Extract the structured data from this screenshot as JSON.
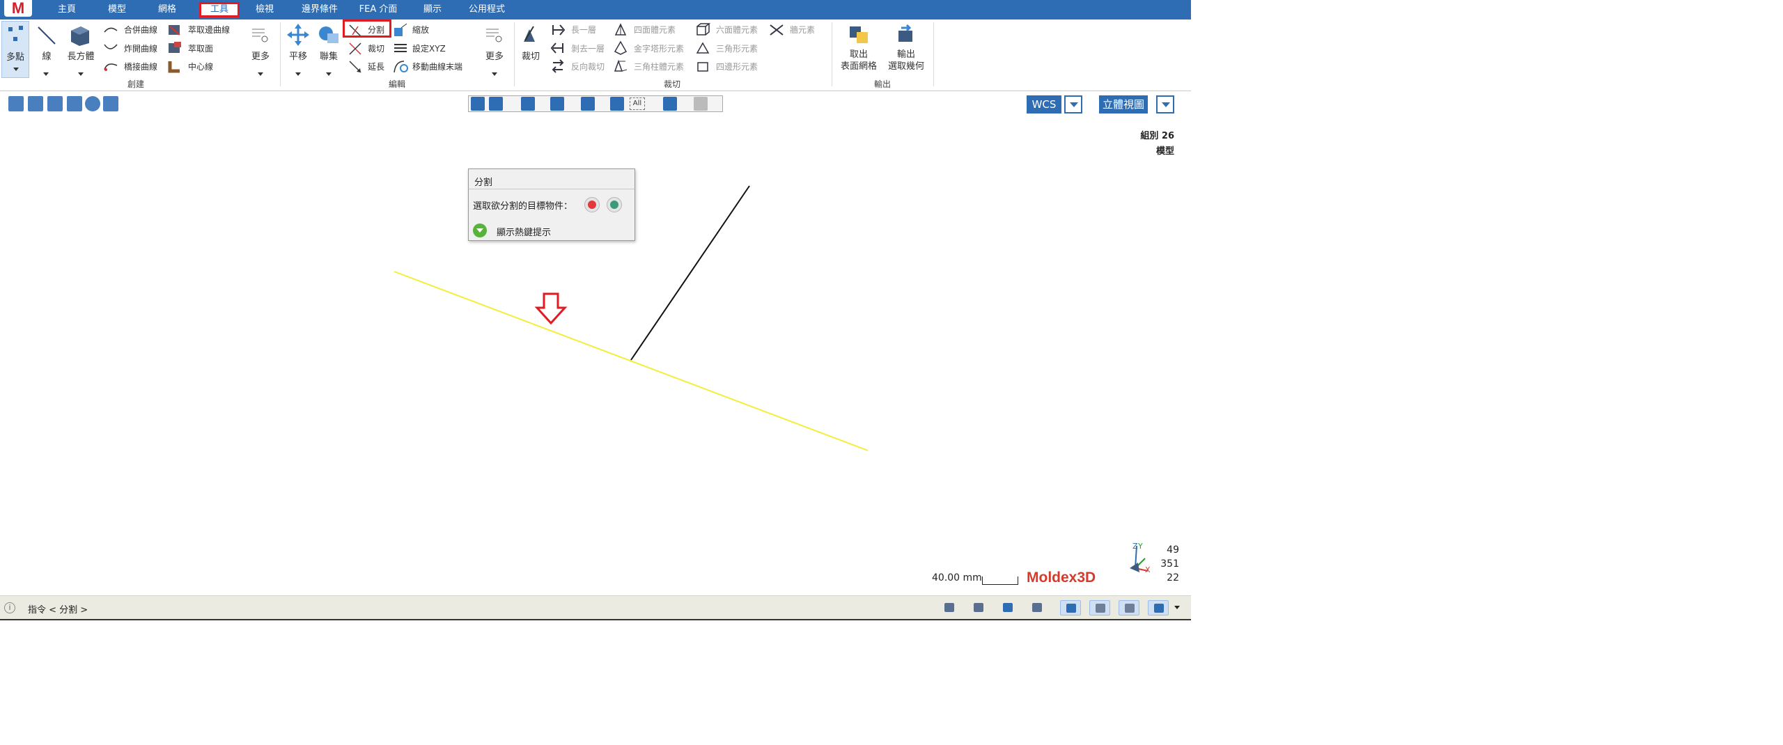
{
  "logo_letter": "M",
  "tabs": [
    "主頁",
    "模型",
    "網格",
    "工具",
    "檢視",
    "邊界條件",
    "FEA 介面",
    "顯示",
    "公用程式"
  ],
  "active_tab": "工具",
  "ribbon": {
    "create_group": {
      "label": "創建",
      "multi_point": "多點",
      "line": "線",
      "cuboid": "長方體",
      "merge_curve": "合併曲線",
      "open_curve": "炸開曲線",
      "bridge_curve": "橋接曲線",
      "extract_boundary_curve": "萃取邊曲線",
      "extract_surface": "萃取面",
      "centerline": "中心線",
      "more": "更多"
    },
    "edit_group": {
      "label": "編輯",
      "move": "平移",
      "join": "聯集",
      "split": "分割",
      "trim": "裁切",
      "extend": "延長",
      "scale": "縮放",
      "set_xyz": "設定XYZ",
      "move_curve_end": "移動曲線末端",
      "more": "更多"
    },
    "trim_group": {
      "label": "裁切",
      "trim": "裁切",
      "layer1": "長一層",
      "remove_layer": "剝去一層",
      "reverse_trim": "反向裁切",
      "tetra": "四面體元素",
      "pyramid": "金字塔形元素",
      "prism": "三角柱體元素",
      "hexa": "六面體元素",
      "tri": "三角形元素",
      "quad": "四邊形元素",
      "wall": "牆元素"
    },
    "output_group": {
      "label": "輸出",
      "extract_mesh_line1": "取出",
      "extract_mesh_line2": "表面網格",
      "output_geom_line1": "輸出",
      "output_geom_line2": "選取幾何"
    }
  },
  "toolbar2": {
    "wcs": "WCS",
    "view": "立體視圖",
    "filter_all": "All"
  },
  "info": {
    "group": "組別 26",
    "mode": "模型"
  },
  "dialog": {
    "title": "分割",
    "prompt": "選取欲分割的目標物件：",
    "hint": "顯示熱鍵提示"
  },
  "scale_label": "40.00 mm",
  "brand": "Moldex3D",
  "coords": [
    "49",
    "351",
    "22"
  ],
  "axis_labels": {
    "z": "Z",
    "y": "Y",
    "x": "X"
  },
  "status": {
    "command": "指令 < 分割 >"
  },
  "colors": {
    "accent": "#2e6db4",
    "highlight": "#e11b22",
    "yellow_line": "#f2ee3a",
    "black_line": "#111111"
  }
}
